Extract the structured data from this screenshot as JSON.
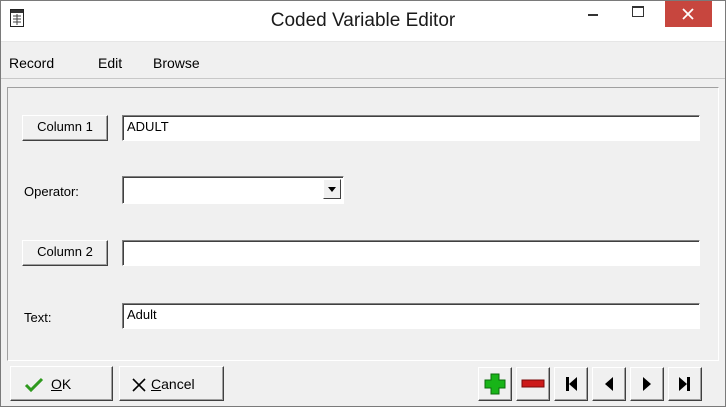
{
  "window": {
    "title": "Coded Variable Editor"
  },
  "menu": {
    "items": [
      "Record",
      "Edit",
      "Browse"
    ]
  },
  "form": {
    "column1": {
      "button_label": "Column 1",
      "value": "ADULT"
    },
    "operator": {
      "label": "Operator:",
      "value": ""
    },
    "column2": {
      "button_label": "Column 2",
      "value": ""
    },
    "text": {
      "label": "Text:",
      "value": "Adult"
    }
  },
  "actions": {
    "ok": {
      "accel": "O",
      "rest": "K"
    },
    "cancel": {
      "accel": "C",
      "rest": "ancel"
    }
  },
  "nav": {
    "buttons": [
      "add-record",
      "delete-record",
      "first-record",
      "previous-record",
      "next-record",
      "last-record"
    ]
  },
  "colors": {
    "add": "#18b418",
    "delete": "#cc1a1a",
    "ok_check": "#2f9a1e",
    "close_button": "#c7463e"
  }
}
